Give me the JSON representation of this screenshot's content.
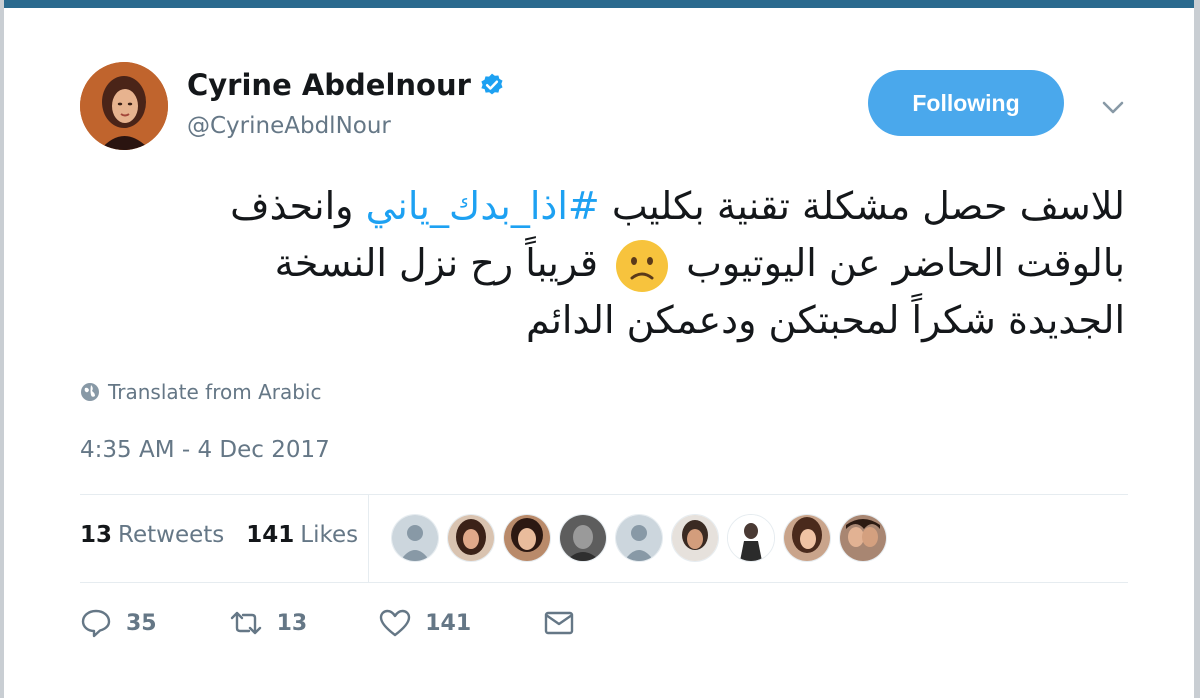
{
  "author": {
    "name": "Cyrine Abdelnour",
    "handle": "@CyrineAbdlNour",
    "verified": true
  },
  "follow_button": {
    "label": "Following"
  },
  "tweet": {
    "lines": [
      {
        "before": "للاسف حصل مشكلة تقنية بكليب ",
        "hashtag": "#اذا_بدك_ياني",
        "after": " وانحذف"
      },
      {
        "before": "بالوقت الحاضر عن اليوتيوب ",
        "emoji": "frowning-face",
        "after": " قريباً رح نزل النسخة"
      },
      {
        "text": "الجديدة شكراً لمحبتكن ودعمكن الدائم"
      }
    ]
  },
  "translate": {
    "label": "Translate from Arabic"
  },
  "timestamp": "4:35 AM - 4 Dec 2017",
  "stats": {
    "retweets_count": "13",
    "retweets_label": "Retweets",
    "likes_count": "141",
    "likes_label": "Likes"
  },
  "likers_count": 9,
  "actions": {
    "reply_count": "35",
    "retweet_count": "13",
    "like_count": "141"
  },
  "colors": {
    "accent": "#1da1f2",
    "button": "#4aa8ec",
    "muted": "#657786",
    "divider": "#e6ecf0"
  }
}
